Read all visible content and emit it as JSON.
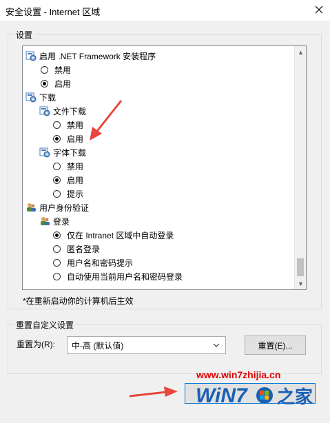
{
  "window": {
    "title": "安全设置 - Internet 区域"
  },
  "settings_group": {
    "label": "设置"
  },
  "tree": [
    {
      "type": "header",
      "icon": "settings-page-icon",
      "label": "启用 .NET Framework 安装程序"
    },
    {
      "type": "radio",
      "label": "禁用",
      "checked": false
    },
    {
      "type": "radio",
      "label": "启用",
      "checked": true
    },
    {
      "type": "header",
      "icon": "settings-page-icon",
      "label": "下载"
    },
    {
      "type": "header",
      "icon": "settings-page-icon",
      "label": "文件下载"
    },
    {
      "type": "radio",
      "label": "禁用",
      "checked": false
    },
    {
      "type": "radio",
      "label": "启用",
      "checked": true
    },
    {
      "type": "header",
      "icon": "settings-page-icon",
      "label": "字体下载"
    },
    {
      "type": "radio",
      "label": "禁用",
      "checked": false
    },
    {
      "type": "radio",
      "label": "启用",
      "checked": true
    },
    {
      "type": "radio",
      "label": "提示",
      "checked": false
    },
    {
      "type": "header",
      "icon": "users-icon",
      "label": "用户身份验证"
    },
    {
      "type": "header",
      "icon": "users-icon",
      "label": "登录"
    },
    {
      "type": "radio",
      "label": "仅在 Intranet 区域中自动登录",
      "checked": true
    },
    {
      "type": "radio",
      "label": "匿名登录",
      "checked": false
    },
    {
      "type": "radio",
      "label": "用户名和密码提示",
      "checked": false
    },
    {
      "type": "radio",
      "label": "自动使用当前用户名和密码登录",
      "checked": false
    }
  ],
  "scrollbar": {
    "position": 0.95
  },
  "restart_note": "*在重新启动你的计算机后生效",
  "reset_group": {
    "label": "重置自定义设置",
    "reset_to_label": "重置为(R):",
    "selected_level": "中-高 (默认值)",
    "reset_button": "重置(E)..."
  },
  "watermark": {
    "url": "www.win7zhijia.cn",
    "logo_text": "WiN7",
    "logo_suffix": "之家"
  },
  "colors": {
    "accent": "#0078d7",
    "watermark_red": "#e00000",
    "arrow": "#e8453c"
  }
}
